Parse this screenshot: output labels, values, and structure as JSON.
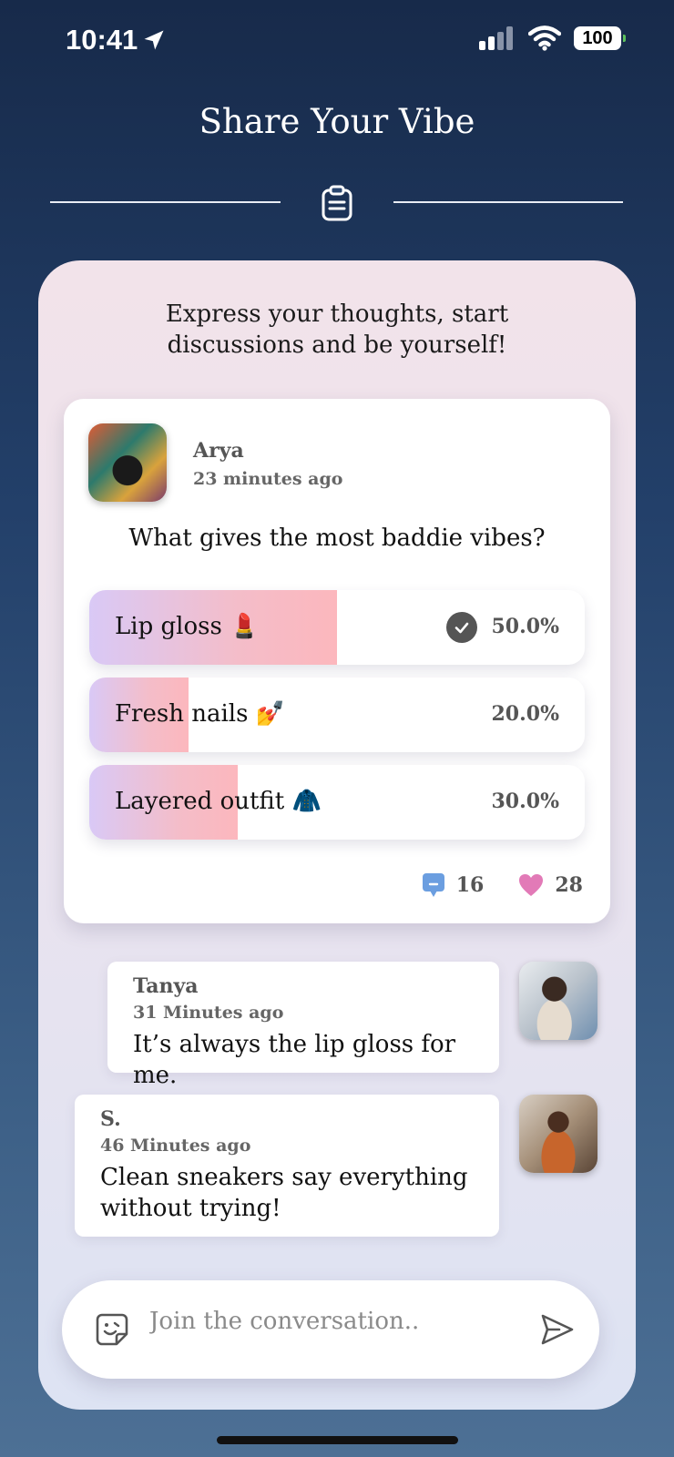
{
  "status_bar": {
    "time": "10:41",
    "battery": "100"
  },
  "header": {
    "title": "Share Your Vibe"
  },
  "panel": {
    "subtitle_line1": "Express your thoughts, start",
    "subtitle_line2": "discussions and be yourself!"
  },
  "post": {
    "author": "Arya",
    "time": "23 minutes ago",
    "question": "What gives the most baddie vibes?",
    "options": [
      {
        "label": "Lip gloss 💄",
        "percent": "50.0%",
        "value": 0.5,
        "selected": true
      },
      {
        "label": "Fresh nails 💅",
        "percent": "20.0%",
        "value": 0.2,
        "selected": false
      },
      {
        "label": "Layered outfit 🧥",
        "percent": "30.0%",
        "value": 0.3,
        "selected": false
      }
    ],
    "comments_count": "16",
    "likes_count": "28"
  },
  "comments": [
    {
      "name": "Tanya",
      "time": "31 Minutes ago",
      "text": "It’s always the lip gloss for me."
    },
    {
      "name": "S.",
      "time": "46 Minutes ago",
      "text_line1": "Clean sneakers say everything",
      "text_line2": "without trying!"
    }
  ],
  "composer": {
    "placeholder": "Join the conversation.."
  },
  "colors": {
    "background_top": "#172a4a",
    "background_bottom": "#4d7095",
    "like": "#e27ab7",
    "comment_icon": "#6b9ee0",
    "poll_fill_start": "#d9c9f6",
    "poll_fill_end": "#fcb7bd"
  },
  "icons": {
    "location": "location-arrow-icon",
    "clipboard": "clipboard-icon",
    "check": "check-circle-icon",
    "comment": "comment-icon",
    "heart": "heart-icon",
    "emoji": "emoji-sticker-icon",
    "send": "send-icon"
  }
}
